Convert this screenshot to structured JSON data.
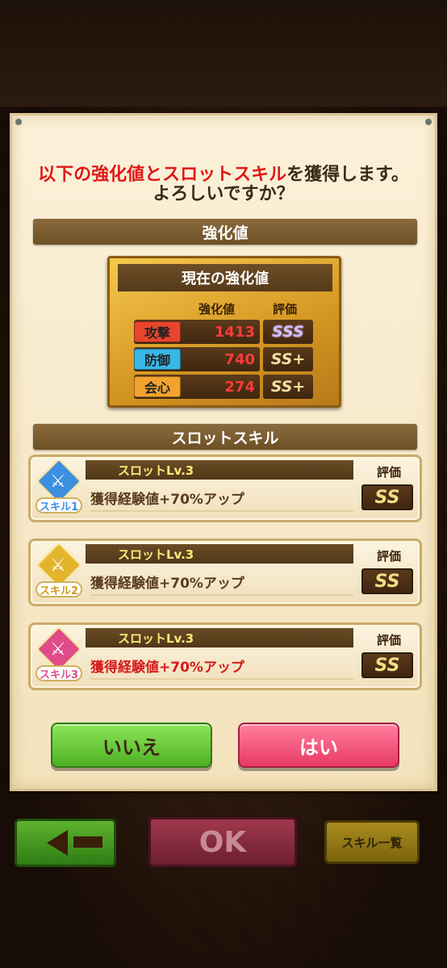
{
  "dialog": {
    "question_part1": "以下の強化値とスロットスキル",
    "question_part2": "を獲得します。",
    "question_line2": "よろしいですか？",
    "section_boost": "強化値",
    "section_slot_skill": "スロットスキル"
  },
  "stats": {
    "header": "現在の強化値",
    "col_value": "強化値",
    "col_grade": "評価",
    "rows": [
      {
        "name": "攻撃",
        "value": "1413",
        "grade": "SSS",
        "color": "#e8452e"
      },
      {
        "name": "防御",
        "value": "740",
        "grade": "SS+",
        "color": "#39b7e6"
      },
      {
        "name": "会心",
        "value": "274",
        "grade": "SS+",
        "color": "#f2a32f"
      }
    ]
  },
  "skills": [
    {
      "tag": "スキル1",
      "slot": "スロットLv.3",
      "effect": "獲得経験値+70%アップ",
      "eval_label": "評価",
      "grade": "SS",
      "color": "#3d8fe0"
    },
    {
      "tag": "スキル2",
      "slot": "スロットLv.3",
      "effect": "獲得経験値+70%アップ",
      "eval_label": "評価",
      "grade": "SS",
      "color": "#e3b52c"
    },
    {
      "tag": "スキル3",
      "slot": "スロットLv.3",
      "effect": "獲得経験値+70%アップ",
      "eval_label": "評価",
      "grade": "SS",
      "color": "#e04b8a"
    }
  ],
  "buttons": {
    "no": "いいえ",
    "yes": "はい"
  },
  "nav": {
    "ok": "OK",
    "skill_list": "スキル一覧",
    "back_icon": "back-arrow-icon"
  }
}
